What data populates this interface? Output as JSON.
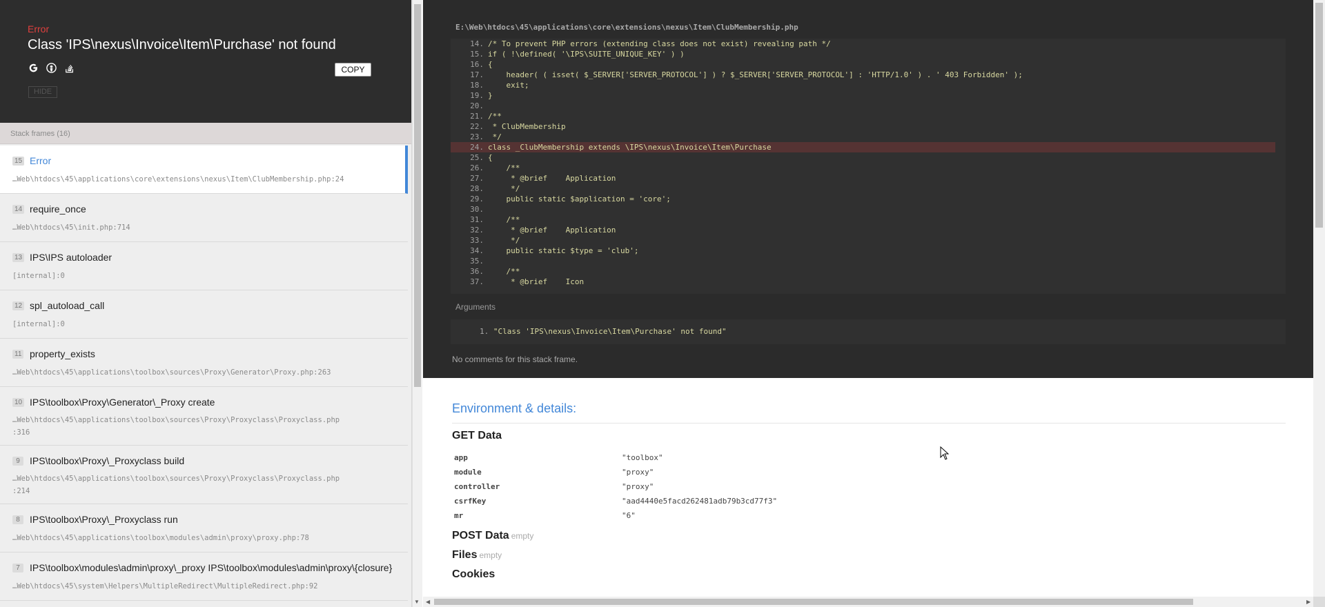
{
  "error": {
    "type": "Error",
    "message": "Class 'IPS\\nexus\\Invoice\\Item\\Purchase' not found",
    "copy_label": "COPY",
    "hide_label": "HIDE",
    "search_icons": [
      "google-icon",
      "duckduckgo-icon",
      "stackoverflow-icon"
    ]
  },
  "frames": {
    "count_label": "Stack frames (16)",
    "items": [
      {
        "num": "15",
        "name": "Error",
        "file": "…Web\\htdocs\\45\\applications\\core\\extensions\\nexus\\Item\\ClubMembership.php:24",
        "active": true
      },
      {
        "num": "14",
        "name": "require_once",
        "file": "…Web\\htdocs\\45\\init.php:714"
      },
      {
        "num": "13",
        "name": "IPS\\IPS autoloader",
        "file": "[internal]:0"
      },
      {
        "num": "12",
        "name": "spl_autoload_call",
        "file": "[internal]:0"
      },
      {
        "num": "11",
        "name": "property_exists",
        "file": "…Web\\htdocs\\45\\applications\\toolbox\\sources\\Proxy\\Generator\\Proxy.php:263"
      },
      {
        "num": "10",
        "name": "IPS\\toolbox\\Proxy\\Generator\\_Proxy create",
        "file": "…Web\\htdocs\\45\\applications\\toolbox\\sources\\Proxy\\Proxyclass\\Proxyclass.php",
        "file2": ":316"
      },
      {
        "num": "9",
        "name": "IPS\\toolbox\\Proxy\\_Proxyclass build",
        "file": "…Web\\htdocs\\45\\applications\\toolbox\\sources\\Proxy\\Proxyclass\\Proxyclass.php",
        "file2": ":214"
      },
      {
        "num": "8",
        "name": "IPS\\toolbox\\Proxy\\_Proxyclass run",
        "file": "…Web\\htdocs\\45\\applications\\toolbox\\modules\\admin\\proxy\\proxy.php:78"
      },
      {
        "num": "7",
        "name": "IPS\\toolbox\\modules\\admin\\proxy\\_proxy IPS\\toolbox\\modules\\admin\\proxy\\{closure}",
        "file": "…Web\\htdocs\\45\\system\\Helpers\\MultipleRedirect\\MultipleRedirect.php:92"
      }
    ]
  },
  "code": {
    "path": "E:\\Web\\htdocs\\45\\applications\\core\\extensions\\nexus\\Item\\ClubMembership.php",
    "highlight_line": "24.",
    "lines": [
      {
        "n": "14.",
        "t": "/* To prevent PHP errors (extending class does not exist) revealing path */"
      },
      {
        "n": "15.",
        "t": "if ( !\\defined( '\\IPS\\SUITE_UNIQUE_KEY' ) )"
      },
      {
        "n": "16.",
        "t": "{"
      },
      {
        "n": "17.",
        "t": "    header( ( isset( $_SERVER['SERVER_PROTOCOL'] ) ? $_SERVER['SERVER_PROTOCOL'] : 'HTTP/1.0' ) . ' 403 Forbidden' );"
      },
      {
        "n": "18.",
        "t": "    exit;"
      },
      {
        "n": "19.",
        "t": "}"
      },
      {
        "n": "20.",
        "t": ""
      },
      {
        "n": "21.",
        "t": "/**"
      },
      {
        "n": "22.",
        "t": " * ClubMembership"
      },
      {
        "n": "23.",
        "t": " */"
      },
      {
        "n": "24.",
        "t": "class _ClubMembership extends \\IPS\\nexus\\Invoice\\Item\\Purchase"
      },
      {
        "n": "25.",
        "t": "{"
      },
      {
        "n": "26.",
        "t": "    /**"
      },
      {
        "n": "27.",
        "t": "     * @brief    Application"
      },
      {
        "n": "28.",
        "t": "     */"
      },
      {
        "n": "29.",
        "t": "    public static $application = 'core';"
      },
      {
        "n": "30.",
        "t": ""
      },
      {
        "n": "31.",
        "t": "    /**"
      },
      {
        "n": "32.",
        "t": "     * @brief    Application"
      },
      {
        "n": "33.",
        "t": "     */"
      },
      {
        "n": "34.",
        "t": "    public static $type = 'club';"
      },
      {
        "n": "35.",
        "t": ""
      },
      {
        "n": "36.",
        "t": "    /**"
      },
      {
        "n": "37.",
        "t": "     * @brief    Icon"
      }
    ],
    "arguments_label": "Arguments",
    "argument_index": "1.",
    "argument_value": "\"Class 'IPS\\nexus\\Invoice\\Item\\Purchase' not found\"",
    "no_comments": "No comments for this stack frame."
  },
  "env": {
    "title": "Environment & details:",
    "get_title": "GET Data",
    "get_data": [
      {
        "key": "app",
        "value": "\"toolbox\""
      },
      {
        "key": "module",
        "value": "\"proxy\""
      },
      {
        "key": "controller",
        "value": "\"proxy\""
      },
      {
        "key": "csrfKey",
        "value": "\"aad4440e5facd262481adb79b3cd77f3\""
      },
      {
        "key": "mr",
        "value": "\"6\""
      }
    ],
    "post_title": "POST Data",
    "post_empty": "empty",
    "files_title": "Files",
    "files_empty": "empty",
    "cookies_title": "Cookies"
  },
  "colors": {
    "accent": "#4287d8",
    "error_red": "#e0403e",
    "code_bg": "#2b2b2b",
    "highlight_bg": "#553333"
  }
}
